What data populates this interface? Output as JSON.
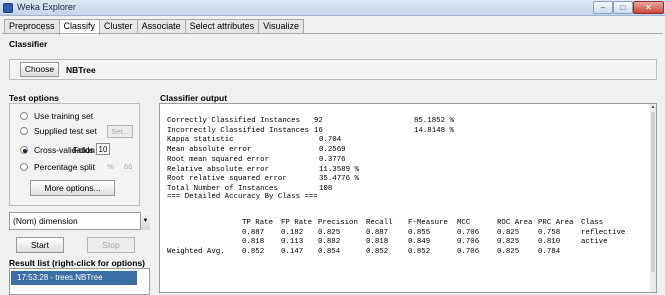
{
  "window": {
    "title": "Weka Explorer",
    "min": "–",
    "max": "□",
    "close": "✕"
  },
  "tabs": [
    {
      "label": "Preprocess",
      "active": false
    },
    {
      "label": "Classify",
      "active": true
    },
    {
      "label": "Cluster",
      "active": false
    },
    {
      "label": "Associate",
      "active": false
    },
    {
      "label": "Select attributes",
      "active": false
    },
    {
      "label": "Visualize",
      "active": false
    }
  ],
  "classifier": {
    "label": "Classifier",
    "choose_label": "Choose",
    "name": "NBTree"
  },
  "test_options": {
    "label": "Test options",
    "use_training_set": "Use training set",
    "supplied_test_set": "Supplied test set",
    "set_label": "Set...",
    "cross_validation": "Cross-validation",
    "folds_label": "Folds",
    "folds_value": "10",
    "percentage_split": "Percentage split",
    "percent_symbol": "%",
    "percent_value": "66",
    "more_options": "More options...",
    "selected": "cross_validation"
  },
  "class_attribute": {
    "value": "(Nom) dimension",
    "arrow": "▼"
  },
  "run": {
    "start_label": "Start",
    "stop_label": "Stop"
  },
  "result_list": {
    "label": "Result list (right-click for options)",
    "items": [
      "17:53:28 - trees.NBTree"
    ]
  },
  "output": {
    "label": "Classifier output",
    "summary": [
      {
        "name": "Correctly Classified Instances",
        "value": "92",
        "percent": "85.1852 %"
      },
      {
        "name": "Incorrectly Classified Instances",
        "value": "16",
        "percent": "14.8148 %"
      },
      {
        "name": "Kappa statistic",
        "value": "0.704",
        "percent": ""
      },
      {
        "name": "Mean absolute error",
        "value": "0.2569",
        "percent": ""
      },
      {
        "name": "Root mean squared error",
        "value": "0.3776",
        "percent": ""
      },
      {
        "name": "Relative absolute error",
        "value": "11.3589 %",
        "percent": ""
      },
      {
        "name": "Root relative squared error",
        "value": "35.4776 %",
        "percent": ""
      },
      {
        "name": "Total Number of Instances",
        "value": "108",
        "percent": ""
      }
    ],
    "accuracy_heading": "=== Detailed Accuracy By Class ===",
    "accuracy_headers": [
      "TP Rate",
      "FP Rate",
      "Precision",
      "Recall",
      "F-Measure",
      "MCC",
      "ROC Area",
      "PRC Area",
      "Class"
    ],
    "accuracy_rows": [
      {
        "label": "",
        "cells": [
          "0.887",
          "0.182",
          "0.825",
          "0.887",
          "0.855",
          "0.706",
          "0.825",
          "0.758",
          "reflective"
        ]
      },
      {
        "label": "",
        "cells": [
          "0.818",
          "0.113",
          "0.882",
          "0.818",
          "0.849",
          "0.706",
          "0.825",
          "0.810",
          "active"
        ]
      },
      {
        "label": "Weighted Avg.",
        "cells": [
          "0.852",
          "0.147",
          "0.854",
          "0.852",
          "0.852",
          "0.706",
          "0.825",
          "0.784",
          ""
        ]
      }
    ]
  }
}
